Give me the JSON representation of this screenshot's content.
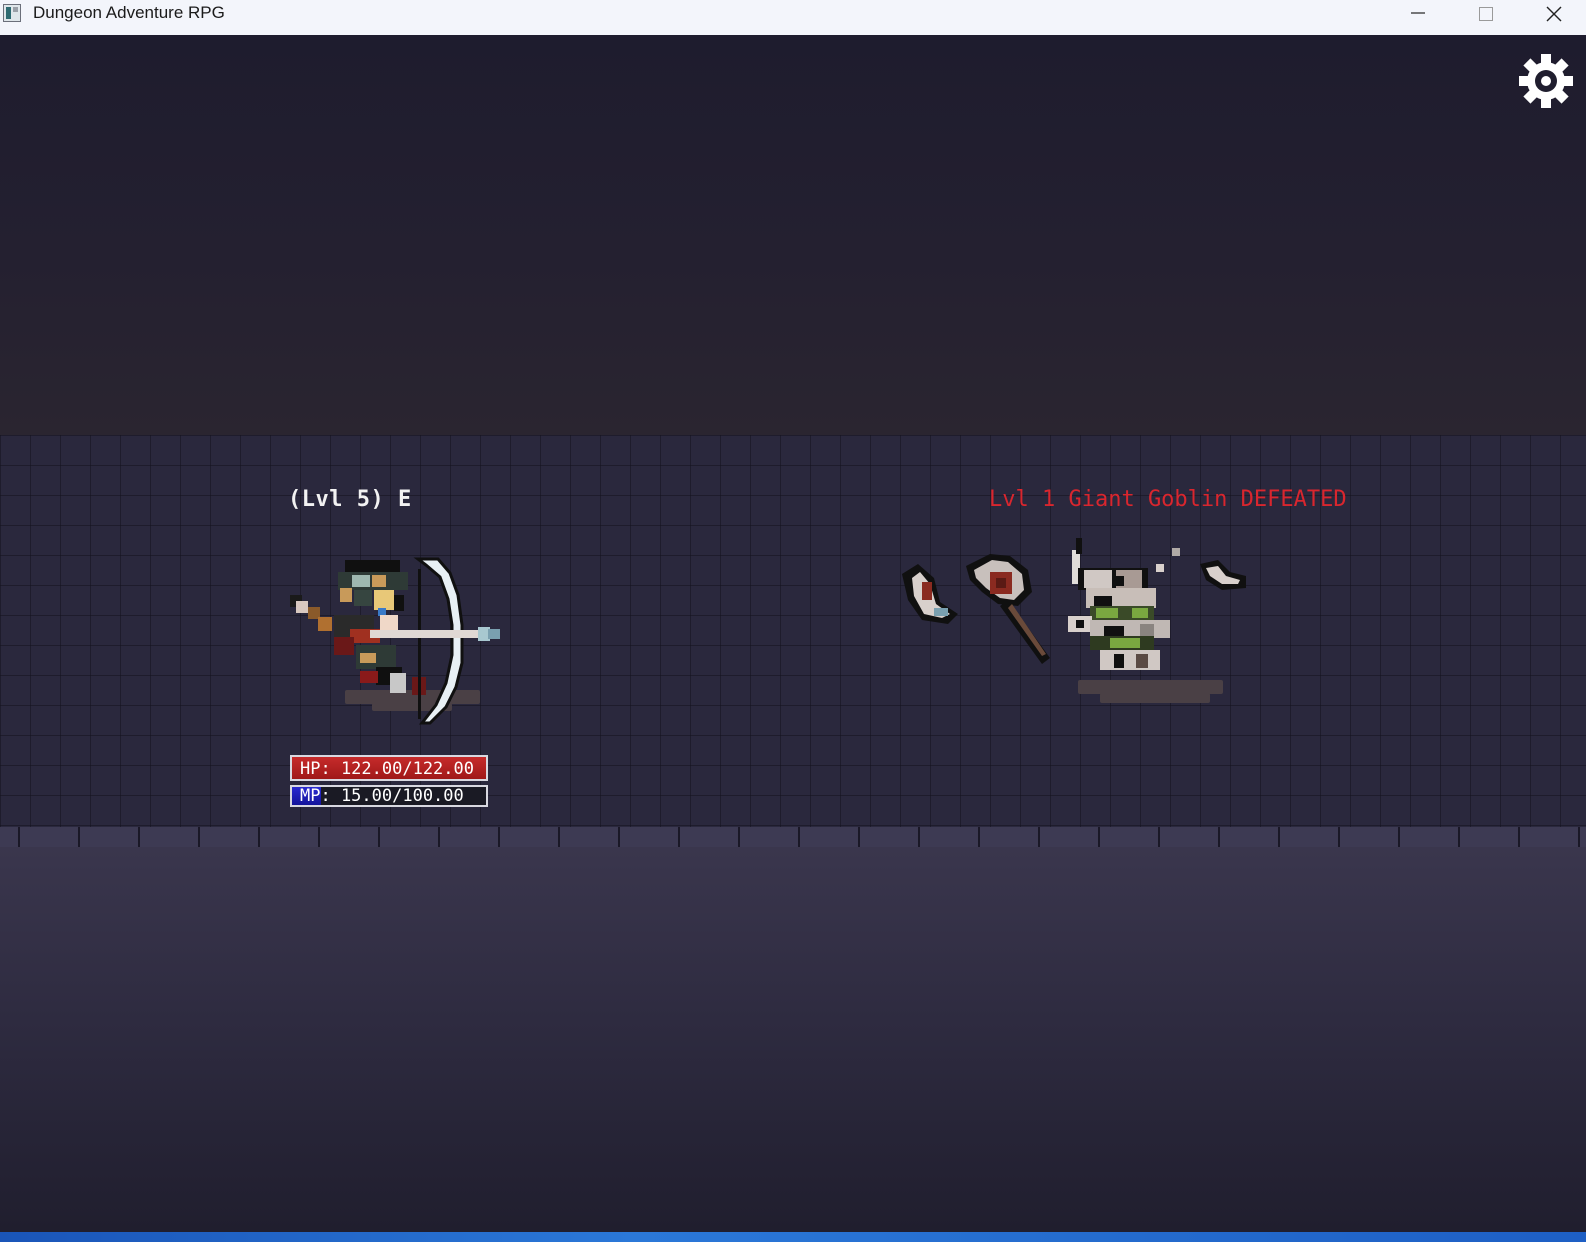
{
  "window": {
    "title": "Dungeon Adventure RPG",
    "controls": [
      "minimize",
      "maximize",
      "close"
    ]
  },
  "settings": {
    "icon": "gear-icon"
  },
  "player": {
    "label": "(Lvl 5) E",
    "hp_text": "HP: 122.00/122.00",
    "hp_fraction": 1.0,
    "mp_text": "MP: 15.00/100.00",
    "mp_fraction": 0.15,
    "hp_color": "#c62b2b",
    "mp_color": "#2a2ad0"
  },
  "enemy": {
    "status_text": "Lvl 1 Giant Goblin DEFEATED",
    "status_color": "#d9262e"
  }
}
